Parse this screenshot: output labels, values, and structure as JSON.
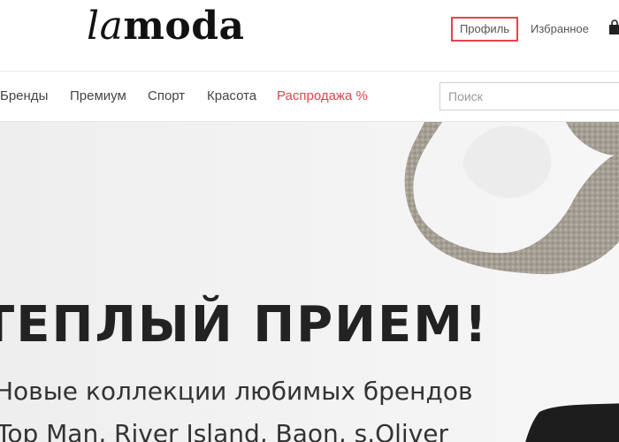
{
  "header": {
    "logo_la": "la",
    "logo_moda": "moda",
    "profile_label": "Профиль",
    "favorites_label": "Избранное",
    "cart_icon": "shopping-bag-icon"
  },
  "nav": {
    "items": [
      "Бренды",
      "Премиум",
      "Спорт",
      "Красота"
    ],
    "sale_label": "Распродажа %",
    "search_placeholder": "Поиск",
    "search_value": ""
  },
  "hero": {
    "headline": "ТЕПЛЫЙ ПРИЕМ!",
    "subline": "Новые коллекции любимых брендов",
    "brands": "Top Man, River Island, Baon, s.Oliver"
  },
  "colors": {
    "accent": "#e0424c",
    "highlight_border": "#e4434f"
  }
}
